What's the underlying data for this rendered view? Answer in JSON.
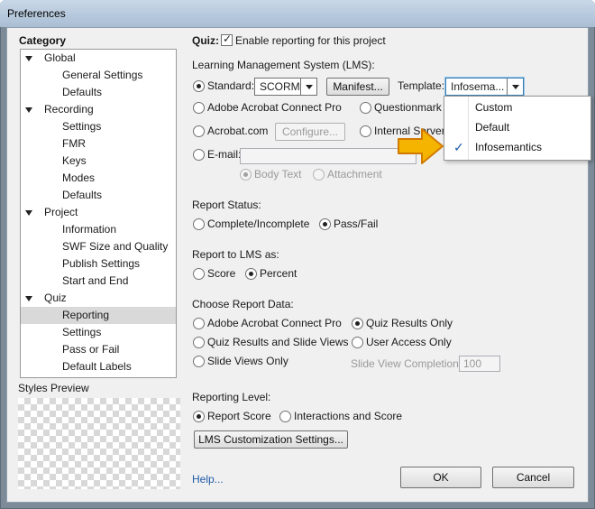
{
  "window": {
    "title": "Preferences"
  },
  "category": {
    "title": "Category",
    "items": [
      {
        "label": "Global"
      },
      {
        "label": "General Settings"
      },
      {
        "label": "Defaults"
      },
      {
        "label": "Recording"
      },
      {
        "label": "Settings"
      },
      {
        "label": "FMR"
      },
      {
        "label": "Keys"
      },
      {
        "label": "Modes"
      },
      {
        "label": "Defaults"
      },
      {
        "label": "Project"
      },
      {
        "label": "Information"
      },
      {
        "label": "SWF Size and Quality"
      },
      {
        "label": "Publish Settings"
      },
      {
        "label": "Start and End"
      },
      {
        "label": "Quiz"
      },
      {
        "label": "Reporting",
        "selected": true
      },
      {
        "label": "Settings"
      },
      {
        "label": "Pass or Fail"
      },
      {
        "label": "Default Labels"
      }
    ]
  },
  "styles_preview": {
    "title": "Styles Preview"
  },
  "quiz": {
    "label": "Quiz:",
    "enable_label": "Enable reporting for this project",
    "enabled": true
  },
  "lms": {
    "title": "Learning Management System (LMS):",
    "standard_label": "Standard:",
    "standard_value": "SCORM",
    "manifest_button": "Manifest...",
    "template_label": "Template:",
    "template_value": "Infosema...",
    "adobe_connect_label": "Adobe Acrobat Connect Pro",
    "questionmark_label": "Questionmark P",
    "acrobat_label": "Acrobat.com",
    "configure_button": "Configure...",
    "internal_server_label": "Internal Server",
    "email_label": "E-mail:",
    "body_text_label": "Body Text",
    "attachment_label": "Attachment"
  },
  "template_menu": {
    "options": [
      {
        "label": "Custom"
      },
      {
        "label": "Default"
      },
      {
        "label": "Infosemantics",
        "checked": true
      }
    ],
    "check_glyph": "✓"
  },
  "report_status": {
    "title": "Report Status:",
    "complete_label": "Complete/Incomplete",
    "pass_fail_label": "Pass/Fail"
  },
  "report_to_lms": {
    "title": "Report to LMS as:",
    "score_label": "Score",
    "percent_label": "Percent"
  },
  "report_data": {
    "title": "Choose Report Data:",
    "adobe_connect_label": "Adobe Acrobat Connect Pro",
    "quiz_results_only_label": "Quiz Results Only",
    "quiz_and_slide_label": "Quiz Results and Slide Views",
    "user_access_label": "User Access Only",
    "slide_views_only_label": "Slide Views Only",
    "slide_view_completion_label": "Slide View Completion",
    "slide_view_completion_value": "100"
  },
  "reporting_level": {
    "title": "Reporting Level:",
    "report_score_label": "Report Score",
    "interactions_label": "Interactions and Score",
    "customization_button": "LMS Customization Settings..."
  },
  "footer": {
    "help_link": "Help...",
    "ok_button": "OK",
    "cancel_button": "Cancel"
  },
  "colors": {
    "arrow_fill": "#f5b400",
    "arrow_stroke": "#d07a00",
    "link": "#1f5aa6",
    "check": "#1b5cab"
  }
}
